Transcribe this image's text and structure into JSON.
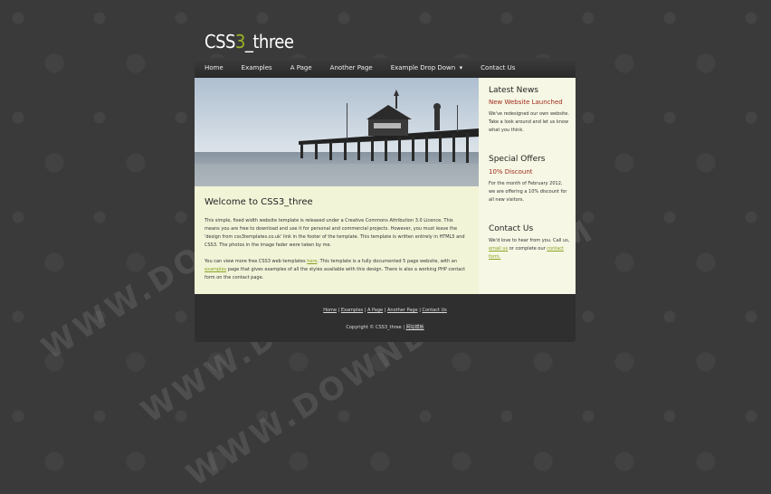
{
  "logo": {
    "part1": "CSS",
    "part2": "3",
    "part3": "_three"
  },
  "menu": [
    "Home",
    "Examples",
    "A Page",
    "Another Page",
    "Example Drop Down",
    "Contact Us"
  ],
  "menu_arrow": "▾",
  "main": {
    "heading": "Welcome to CSS3_three",
    "p1": "This simple, fixed width website template is released under a Creative Commons Attribution 3.0 Licence. This means you are free to download and use it for personal and commercial projects. However, you must leave the 'design from css3templates.co.uk' link in the footer of the template. This template is written entirely in HTML5 and CSS3. The photos in the image fader were taken by me.",
    "p2a": "You can view more free CSS3 web templates ",
    "p2link1": "here",
    "p2b": ". This template is a fully documented 5 page website, with an ",
    "p2link2": "examples",
    "p2c": " page that gives examples of all the styles available with this design. There is also a working PHP contact form on the contact page."
  },
  "sidebar": {
    "news_title": "Latest News",
    "news_sub": "New Website Launched",
    "news_text": "We've redesigned our own website. Take a look around and let us know what you think.",
    "offers_title": "Special Offers",
    "offers_sub": "10% Discount",
    "offers_text": "For the month of February 2012, we are offering a 10% discount for all new visitors.",
    "contact_title": "Contact Us",
    "contact_a": "We'd love to hear from you. Call us, ",
    "contact_link1": "email us",
    "contact_b": " or complete our ",
    "contact_link2": "contact form."
  },
  "footer": {
    "links": [
      "Home",
      "Examples",
      "A Page",
      "Another Page",
      "Contact Us"
    ],
    "sep": " | ",
    "copyright": "Copyright © CSS3_three | ",
    "copyright_link": "网站模板"
  },
  "watermark": "WWW.DOWNDEMO.COM"
}
